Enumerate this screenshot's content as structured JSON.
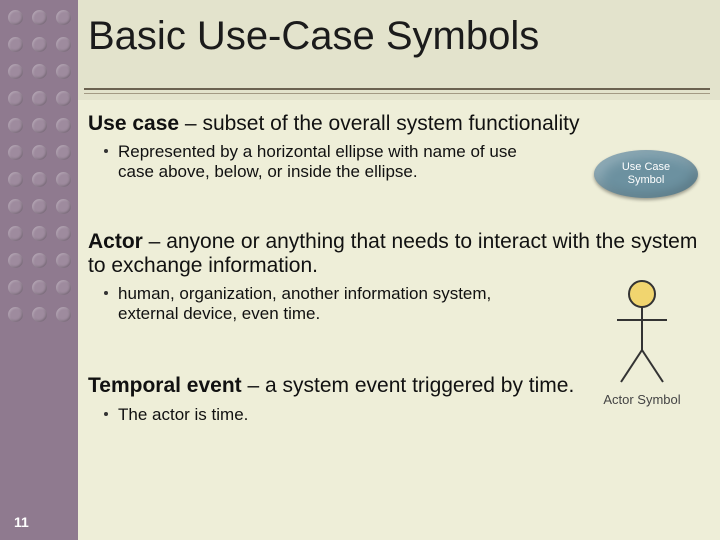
{
  "page_number": "11",
  "title": "Basic Use-Case Symbols",
  "usecase": {
    "term": "Use case",
    "dash": " – ",
    "def": "subset of the overall system functionality",
    "bullet": "Represented by a horizontal ellipse with name of use case above, below, or inside the ellipse.",
    "symbol_label_line1": "Use Case",
    "symbol_label_line2": "Symbol"
  },
  "actor": {
    "term": "Actor",
    "dash": " – ",
    "def": "anyone or anything that needs to interact with the system to exchange information.",
    "bullet": "human, organization, another information system, external device, even time.",
    "symbol_label": "Actor Symbol"
  },
  "temporal": {
    "term": "Temporal event",
    "dash": " – ",
    "def": "a system event triggered by time.",
    "bullet": "The actor is time."
  }
}
